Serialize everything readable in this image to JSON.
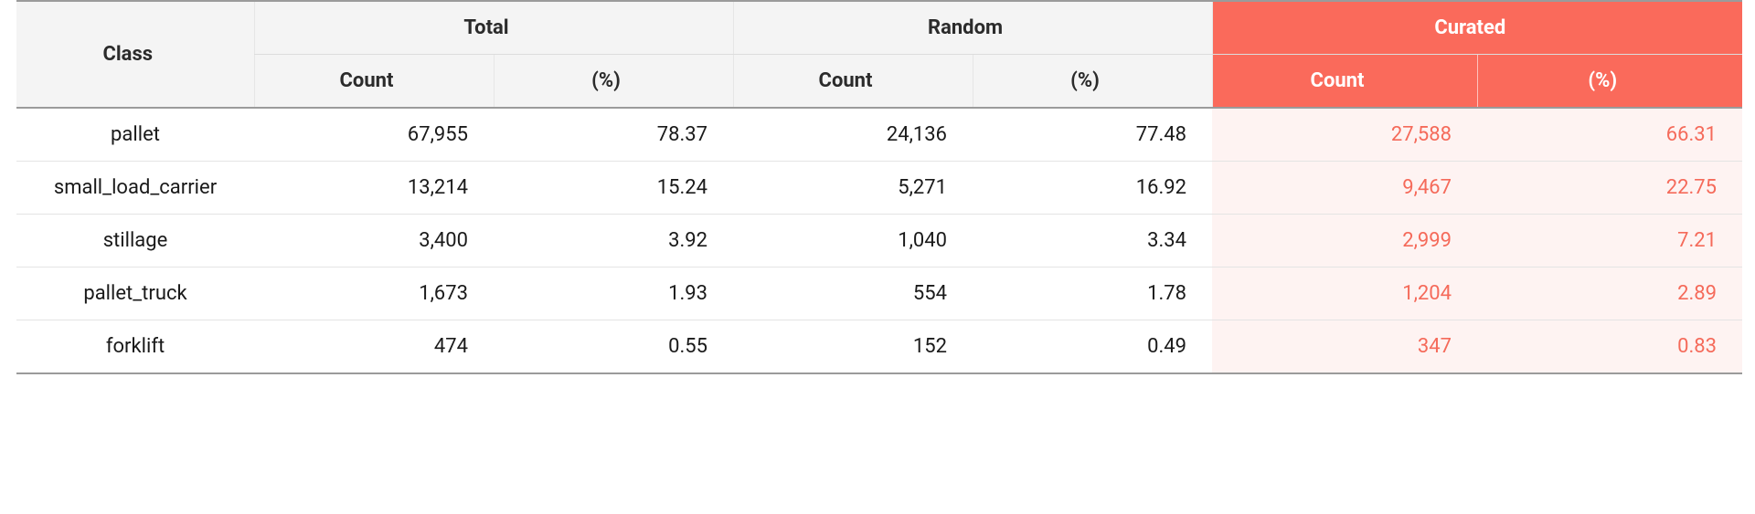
{
  "chart_data": {
    "type": "table",
    "title": "",
    "columns": [
      {
        "group": "",
        "label": "Class"
      },
      {
        "group": "Total",
        "label": "Count"
      },
      {
        "group": "Total",
        "label": "(%)"
      },
      {
        "group": "Random",
        "label": "Count"
      },
      {
        "group": "Random",
        "label": "(%)"
      },
      {
        "group": "Curated",
        "label": "Count",
        "highlighted": true
      },
      {
        "group": "Curated",
        "label": "(%)",
        "highlighted": true
      }
    ],
    "rows": [
      {
        "class": "pallet",
        "total_count": 67955,
        "total_pct": 78.37,
        "random_count": 24136,
        "random_pct": 77.48,
        "curated_count": 27588,
        "curated_pct": 66.31
      },
      {
        "class": "small_load_carrier",
        "total_count": 13214,
        "total_pct": 15.24,
        "random_count": 5271,
        "random_pct": 16.92,
        "curated_count": 9467,
        "curated_pct": 22.75
      },
      {
        "class": "stillage",
        "total_count": 3400,
        "total_pct": 3.92,
        "random_count": 1040,
        "random_pct": 3.34,
        "curated_count": 2999,
        "curated_pct": 7.21
      },
      {
        "class": "pallet_truck",
        "total_count": 1673,
        "total_pct": 1.93,
        "random_count": 554,
        "random_pct": 1.78,
        "curated_count": 1204,
        "curated_pct": 2.89
      },
      {
        "class": "forklift",
        "total_count": 474,
        "total_pct": 0.55,
        "random_count": 152,
        "random_pct": 0.49,
        "curated_count": 347,
        "curated_pct": 0.83
      }
    ]
  },
  "headers": {
    "class": "Class",
    "groups": {
      "total": "Total",
      "random": "Random",
      "curated": "Curated"
    },
    "sub": {
      "count": "Count",
      "pct": "(%)"
    }
  },
  "rows": [
    {
      "class": "pallet",
      "total_count": "67,955",
      "total_pct": "78.37",
      "random_count": "24,136",
      "random_pct": "77.48",
      "curated_count": "27,588",
      "curated_pct": "66.31"
    },
    {
      "class": "small_load_carrier",
      "total_count": "13,214",
      "total_pct": "15.24",
      "random_count": "5,271",
      "random_pct": "16.92",
      "curated_count": "9,467",
      "curated_pct": "22.75"
    },
    {
      "class": "stillage",
      "total_count": "3,400",
      "total_pct": "3.92",
      "random_count": "1,040",
      "random_pct": "3.34",
      "curated_count": "2,999",
      "curated_pct": "7.21"
    },
    {
      "class": "pallet_truck",
      "total_count": "1,673",
      "total_pct": "1.93",
      "random_count": "554",
      "random_pct": "1.78",
      "curated_count": "1,204",
      "curated_pct": "2.89"
    },
    {
      "class": "forklift",
      "total_count": "474",
      "total_pct": "0.55",
      "random_count": "152",
      "random_pct": "0.49",
      "curated_count": "347",
      "curated_pct": "0.83"
    }
  ]
}
